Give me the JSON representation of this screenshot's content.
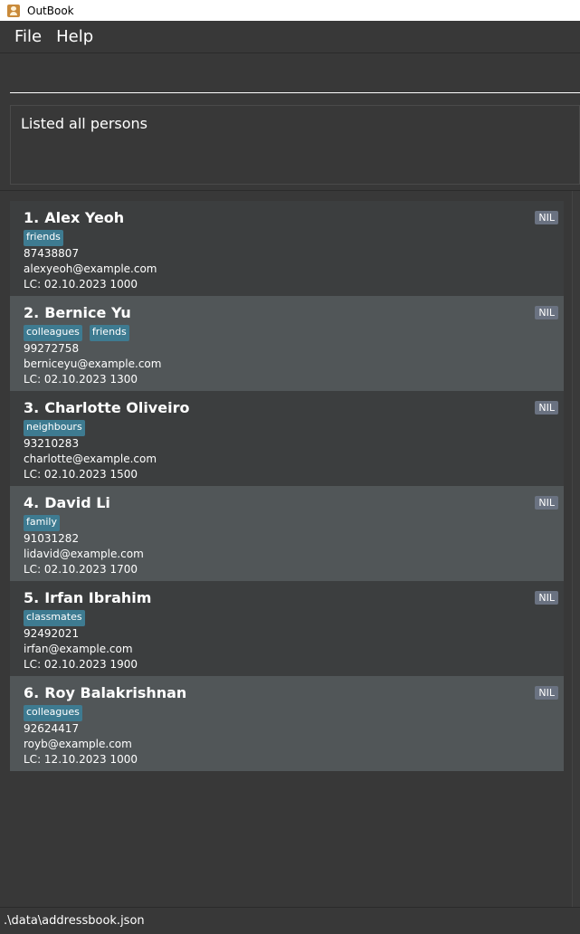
{
  "window": {
    "title": "OutBook"
  },
  "menu": {
    "items": [
      "File",
      "Help"
    ]
  },
  "command": {
    "value": "",
    "placeholder": ""
  },
  "result": {
    "message": "Listed all persons"
  },
  "persons": [
    {
      "index": "1.",
      "name": "Alex Yeoh",
      "tags": [
        "friends"
      ],
      "phone": "87438807",
      "email": "alexyeoh@example.com",
      "last_contacted": "LC: 02.10.2023 1000",
      "badge": "NIL"
    },
    {
      "index": "2.",
      "name": "Bernice Yu",
      "tags": [
        "colleagues",
        "friends"
      ],
      "phone": "99272758",
      "email": "berniceyu@example.com",
      "last_contacted": "LC: 02.10.2023 1300",
      "badge": "NIL"
    },
    {
      "index": "3.",
      "name": "Charlotte Oliveiro",
      "tags": [
        "neighbours"
      ],
      "phone": "93210283",
      "email": "charlotte@example.com",
      "last_contacted": "LC: 02.10.2023 1500",
      "badge": "NIL"
    },
    {
      "index": "4.",
      "name": "David Li",
      "tags": [
        "family"
      ],
      "phone": "91031282",
      "email": "lidavid@example.com",
      "last_contacted": "LC: 02.10.2023 1700",
      "badge": "NIL"
    },
    {
      "index": "5.",
      "name": "Irfan Ibrahim",
      "tags": [
        "classmates"
      ],
      "phone": "92492021",
      "email": "irfan@example.com",
      "last_contacted": "LC: 02.10.2023 1900",
      "badge": "NIL"
    },
    {
      "index": "6.",
      "name": "Roy Balakrishnan",
      "tags": [
        "colleagues"
      ],
      "phone": "92624417",
      "email": "royb@example.com",
      "last_contacted": "LC: 12.10.2023 1000",
      "badge": "NIL"
    }
  ],
  "status": {
    "file_path": ".\\data\\addressbook.json"
  },
  "colors": {
    "background": "#383838",
    "card_odd": "#3c3e3f",
    "card_even": "#515658",
    "tag": "#3e7b91",
    "badge": "#6a7281"
  }
}
